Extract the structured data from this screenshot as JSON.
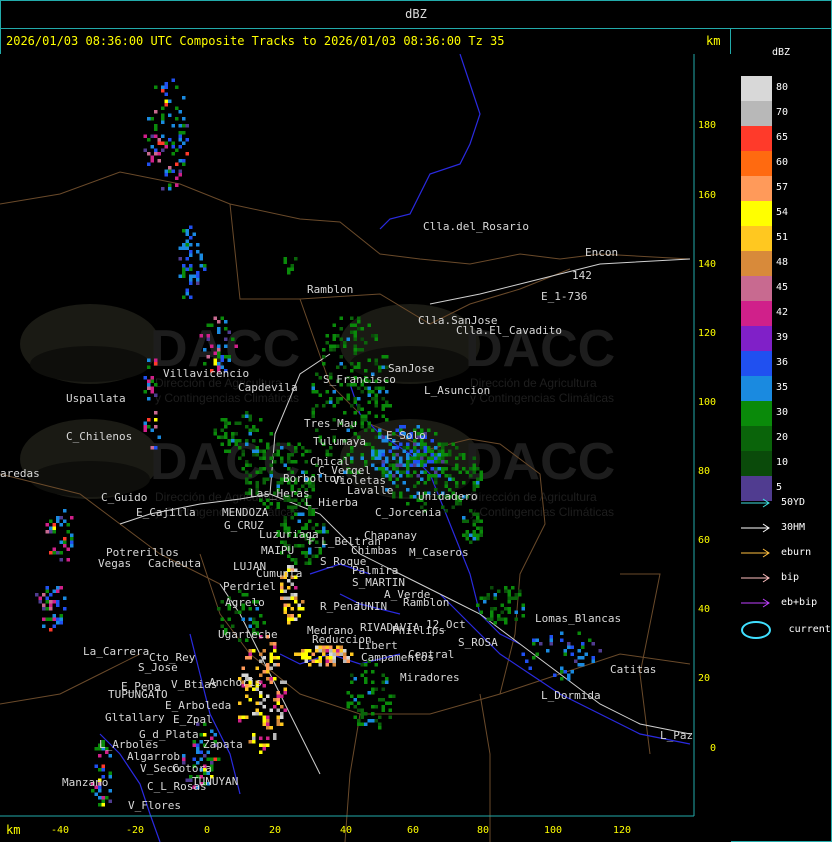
{
  "header": {
    "title": "dBZ",
    "caption": "2026/01/03 08:36:00 UTC Composite Tracks to 2026/01/03 08:36:00 Tz 35",
    "km_top": "km",
    "km_bottom": "km"
  },
  "axes": {
    "x_ticks": [
      "-40",
      "-20",
      "0",
      "20",
      "40",
      "60",
      "80",
      "100",
      "120"
    ],
    "y_ticks": [
      "180",
      "160",
      "140",
      "120",
      "100",
      "80",
      "60",
      "40",
      "20",
      "0"
    ]
  },
  "watermark": {
    "brand": "DACC",
    "line1": "Dirección de Agricultura",
    "line2": "y Contingencias Climáticas"
  },
  "legend": {
    "title": "dBZ",
    "colors": [
      {
        "value": "80",
        "color": "#d8d8d8"
      },
      {
        "value": "70",
        "color": "#b8b8b8"
      },
      {
        "value": "65",
        "color": "#ff3a2a"
      },
      {
        "value": "60",
        "color": "#ff6a10"
      },
      {
        "value": "57",
        "color": "#ff9a5a"
      },
      {
        "value": "54",
        "color": "#ffff00"
      },
      {
        "value": "51",
        "color": "#ffc820"
      },
      {
        "value": "48",
        "color": "#d88a3a"
      },
      {
        "value": "45",
        "color": "#c86a90"
      },
      {
        "value": "42",
        "color": "#d0208a"
      },
      {
        "value": "39",
        "color": "#8020c8"
      },
      {
        "value": "36",
        "color": "#2050f0"
      },
      {
        "value": "35",
        "color": "#1a8ae0"
      },
      {
        "value": "30",
        "color": "#0a8a0a"
      },
      {
        "value": "20",
        "color": "#0a640a"
      },
      {
        "value": "10",
        "color": "#0a4a0a"
      },
      {
        "value": "5",
        "color": "#503c90"
      }
    ],
    "tracks": [
      {
        "label": "50YD",
        "color": "#40e0e0"
      },
      {
        "label": "30HM",
        "color": "#ffffff"
      },
      {
        "label": "eburn",
        "color": "#ffc040"
      },
      {
        "label": "bip",
        "color": "#ffc0c0"
      },
      {
        "label": "eb+bip",
        "color": "#c040ff"
      }
    ],
    "current_label": "current",
    "current_color": "#40e0ff"
  },
  "places": [
    {
      "name": "Clla.del_Rosario"
    },
    {
      "name": "Encon"
    },
    {
      "name": "E_1-736"
    },
    {
      "name": "142"
    },
    {
      "name": "Ramblon"
    },
    {
      "name": "Clla.SanJose"
    },
    {
      "name": "Clla.El_Cavadito"
    },
    {
      "name": "Villavicencio"
    },
    {
      "name": "Capdevila"
    },
    {
      "name": "S_Francisco"
    },
    {
      "name": "SanJose"
    },
    {
      "name": "Uspallata"
    },
    {
      "name": "L_Asuncion"
    },
    {
      "name": "C_Chilenos"
    },
    {
      "name": "Tres_Mau"
    },
    {
      "name": "Tulumaya"
    },
    {
      "name": "E_Solo"
    },
    {
      "name": "Chical"
    },
    {
      "name": "C_Vergel"
    },
    {
      "name": "aredas"
    },
    {
      "name": "Borbollon"
    },
    {
      "name": "Violetas"
    },
    {
      "name": "Lavalle"
    },
    {
      "name": "Unidadero"
    },
    {
      "name": "C_Guido"
    },
    {
      "name": "Las_Heras"
    },
    {
      "name": "L_Hierba"
    },
    {
      "name": "C_Jorcenia"
    },
    {
      "name": "E_Cajilla"
    },
    {
      "name": "MENDOZA"
    },
    {
      "name": "G_CRUZ"
    },
    {
      "name": "Luzuriaga"
    },
    {
      "name": "Chapanay"
    },
    {
      "name": "F_L_Beltran"
    },
    {
      "name": "Chimbas"
    },
    {
      "name": "M_Caseros"
    },
    {
      "name": "Potrerillos"
    },
    {
      "name": "Vegas"
    },
    {
      "name": "Cacheuta"
    },
    {
      "name": "MAIPU"
    },
    {
      "name": "S_Roque"
    },
    {
      "name": "Palmira"
    },
    {
      "name": "LUJAN"
    },
    {
      "name": "Cumunta"
    },
    {
      "name": "S_MARTIN"
    },
    {
      "name": "Perdriel"
    },
    {
      "name": "A_Verde"
    },
    {
      "name": "Ramblon"
    },
    {
      "name": "Agrelo"
    },
    {
      "name": "R_Pena"
    },
    {
      "name": "JUNIN"
    },
    {
      "name": "RIVADAVIA"
    },
    {
      "name": "Phillips"
    },
    {
      "name": "12_Oct"
    },
    {
      "name": "Lomas_Blancas"
    },
    {
      "name": "Ugarteche"
    },
    {
      "name": "La_Carrera"
    },
    {
      "name": "Medrano"
    },
    {
      "name": "Reduccion"
    },
    {
      "name": "S_ROSA"
    },
    {
      "name": "Cto_Rey"
    },
    {
      "name": "S_Jose"
    },
    {
      "name": "Libert"
    },
    {
      "name": "Campamentos"
    },
    {
      "name": "Central"
    },
    {
      "name": "Catitas"
    },
    {
      "name": "E_Pena"
    },
    {
      "name": "V_Btias"
    },
    {
      "name": "Anchoris"
    },
    {
      "name": "TUPUNGATO"
    },
    {
      "name": "Miradores"
    },
    {
      "name": "L_Dormida"
    },
    {
      "name": "E_Arboleda"
    },
    {
      "name": "Gltallary"
    },
    {
      "name": "E_Zpal"
    },
    {
      "name": "L_Paz"
    },
    {
      "name": "G_d_Plata"
    },
    {
      "name": "Zapata"
    },
    {
      "name": "L_Arboles"
    },
    {
      "name": "Algarrob"
    },
    {
      "name": "V_Seco"
    },
    {
      "name": "Cotora"
    },
    {
      "name": "Manzano"
    },
    {
      "name": "TUNUYAN"
    },
    {
      "name": "C_L_Rosas"
    },
    {
      "name": "V_Flores"
    }
  ]
}
